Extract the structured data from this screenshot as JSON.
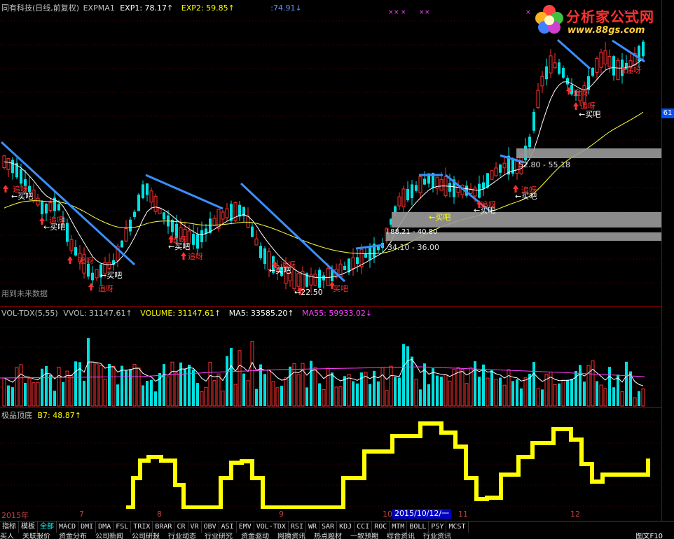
{
  "main": {
    "header": {
      "stock": "同有科技(日线,前复权)",
      "indicator": "EXPMA1",
      "exp1_label": "EXP1: 78.17↑",
      "exp2_label": "EXP2: 59.85↑",
      "extra_label": ":74.91↓",
      "colors": {
        "stock": "#c0c0c0",
        "exp1": "#ffffff",
        "exp2": "#ffff00",
        "extra": "#6090ff"
      }
    },
    "future_note": "用到未来数据",
    "zones": [
      {
        "label": "52.80 - 55.18"
      },
      {
        "label": "34.10 - 36.00"
      }
    ],
    "annotations": {
      "buy": "←买吧",
      "chase": "追呀",
      "buy2": "买吧",
      "low_label": "←22.50",
      "zone_partial": "I 88.21 - 40.80"
    }
  },
  "volume": {
    "header": {
      "name": "VOL-TDX(5,55)",
      "vvol": "VVOL: 31147.61↑",
      "volume": "VOLUME: 31147.61↑",
      "ma5": "MA5: 33585.20↑",
      "ma55": "MA55: 59933.02↓"
    }
  },
  "osc": {
    "header": {
      "name": "极品顶底",
      "b7": "B7: 48.87↑"
    }
  },
  "x_axis": {
    "labels": [
      "2015年",
      "7",
      "8",
      "9",
      "10",
      "11",
      "12"
    ],
    "date_tag": "2015/10/12/一"
  },
  "right_axis": {
    "price_tag": "61"
  },
  "tabs": {
    "items": [
      "指标",
      "模板",
      "全部",
      "MACD",
      "DMI",
      "DMA",
      "FSL",
      "TRIX",
      "BRAR",
      "CR",
      "VR",
      "OBV",
      "ASI",
      "EMV",
      "VOL-TDX",
      "RSI",
      "WR",
      "SAR",
      "KDJ",
      "CCI",
      "ROC",
      "MTM",
      "BOLL",
      "PSY",
      "MCST"
    ],
    "active": "全部"
  },
  "bottom_bar": {
    "items": [
      "买人",
      "关联报价",
      "资金分布",
      "公司新闻",
      "公司研报",
      "行业动态",
      "行业研究",
      "资金驱动",
      "网摘资讯",
      "热点题材",
      "一致预期",
      "综合资讯",
      "行业资讯"
    ],
    "right": "图文F10"
  },
  "logo": {
    "text": "分析家公式网",
    "url": "www.88gs.com"
  },
  "chart_data": [
    {
      "type": "candlestick",
      "title": "同有科技(日线,前复权)",
      "series": [
        {
          "name": "EXP1",
          "last": 78.17
        },
        {
          "name": "EXP2",
          "last": 59.85
        }
      ],
      "price_zones": [
        [
          52.8,
          55.18
        ],
        [
          34.1,
          36.0
        ]
      ],
      "low_marker": 22.5
    },
    {
      "type": "bar",
      "title": "VOL-TDX(5,55)",
      "series": [
        {
          "name": "VVOL",
          "last": 31147.61
        },
        {
          "name": "VOLUME",
          "last": 31147.61
        },
        {
          "name": "MA5",
          "last": 33585.2
        },
        {
          "name": "MA55",
          "last": 59933.02
        }
      ]
    },
    {
      "type": "line",
      "title": "极品顶底",
      "series": [
        {
          "name": "B7",
          "last": 48.87
        }
      ]
    }
  ]
}
